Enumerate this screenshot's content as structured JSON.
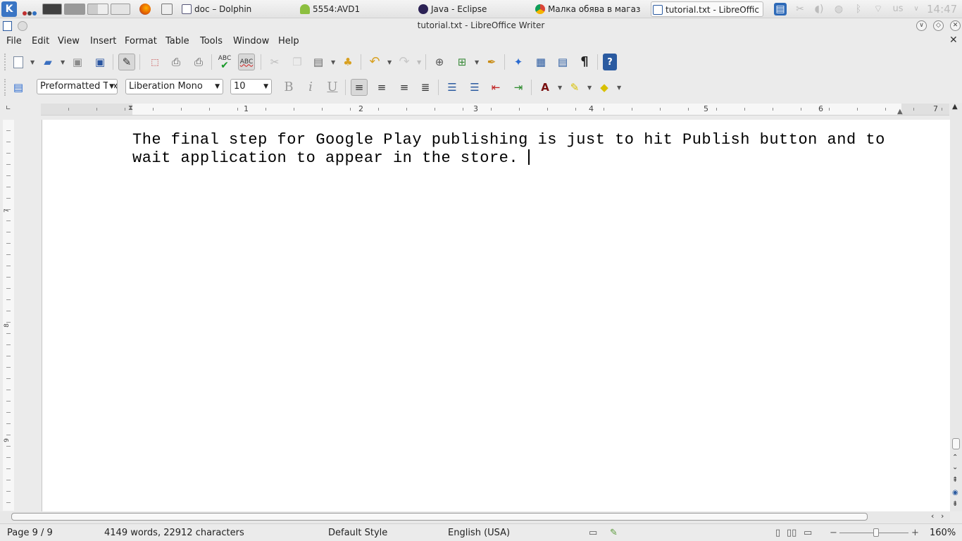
{
  "taskbar": {
    "tasks": [
      {
        "label": "doc – Dolphin"
      },
      {
        "label": "5554:AVD1"
      },
      {
        "label": "Java - Eclipse"
      },
      {
        "label": "Малка обява в магази"
      },
      {
        "label": "tutorial.txt - LibreOffic"
      }
    ],
    "keyboard_layout": "us",
    "clock": "14:47"
  },
  "window": {
    "title": "tutorial.txt - LibreOffice Writer"
  },
  "menu": [
    {
      "label": "File"
    },
    {
      "label": "Edit"
    },
    {
      "label": "View"
    },
    {
      "label": "Insert"
    },
    {
      "label": "Format"
    },
    {
      "label": "Table"
    },
    {
      "label": "Tools"
    },
    {
      "label": "Window"
    },
    {
      "label": "Help"
    }
  ],
  "formatting": {
    "paragraph_style": "Preformatted Text",
    "font_name": "Liberation Mono",
    "font_size": "10",
    "bold_label": "B",
    "italic_label": "i",
    "underline_label": "U"
  },
  "ruler": {
    "marks": [
      "1",
      "2",
      "3",
      "4",
      "5",
      "6",
      "7"
    ],
    "vmarks": [
      "7",
      "8",
      "9"
    ]
  },
  "document": {
    "lines": [
      "The final step for Google Play publishing is just to hit Publish button and to",
      "wait application to appear in the store. "
    ]
  },
  "status": {
    "page": "Page 9 / 9",
    "word_count": "4149 words, 22912 characters",
    "style": "Default Style",
    "language": "English (USA)",
    "zoom": "160%"
  },
  "colors": {
    "accent": "#3a75c4",
    "taskbar_bg": "#eeeeee",
    "page_bg": "#ffffff"
  },
  "icons": {
    "spellcheck_label": "ABC",
    "autospell_label": "ABC",
    "nonprint_label": "¶",
    "help_label": "?"
  }
}
